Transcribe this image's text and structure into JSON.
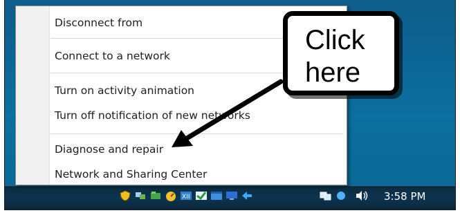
{
  "menu": {
    "items": [
      {
        "label": "Disconnect from"
      },
      {
        "label": "Connect to a network"
      },
      {
        "label": "Turn on activity animation"
      },
      {
        "label": "Turn off notification of new networks"
      },
      {
        "label": "Diagnose and repair"
      },
      {
        "label": "Network and Sharing Center"
      }
    ]
  },
  "callout": {
    "line1": "Click",
    "line2": "here"
  },
  "taskbar": {
    "clock": "3:58 PM",
    "tray_icons": [
      "shield-icon",
      "network-icon",
      "folder-icon",
      "gauge-icon",
      "app-icon",
      "antivirus-icon",
      "window-icon",
      "monitor-icon",
      "arrows-icon",
      "speaker-icon"
    ]
  },
  "colors": {
    "desktop": "#0b6f9f",
    "taskbar": "#0d3450",
    "callout_border": "#000000"
  }
}
